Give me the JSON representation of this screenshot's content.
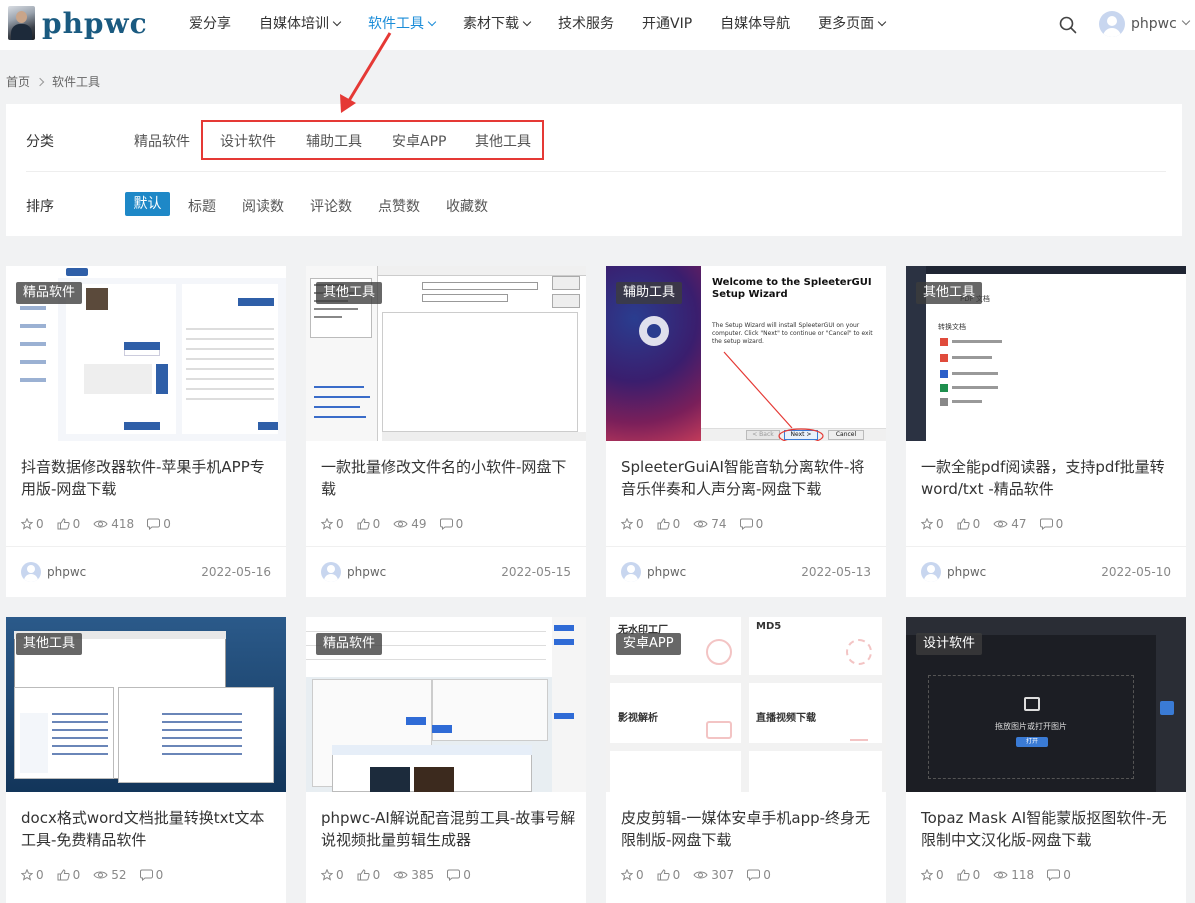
{
  "header": {
    "logo_text": "phpwc",
    "nav": [
      {
        "label": "爱分享",
        "dropdown": false,
        "active": false
      },
      {
        "label": "自媒体培训",
        "dropdown": true,
        "active": false
      },
      {
        "label": "软件工具",
        "dropdown": true,
        "active": true
      },
      {
        "label": "素材下载",
        "dropdown": true,
        "active": false
      },
      {
        "label": "技术服务",
        "dropdown": false,
        "active": false
      },
      {
        "label": "开通VIP",
        "dropdown": false,
        "active": false
      },
      {
        "label": "自媒体导航",
        "dropdown": false,
        "active": false
      },
      {
        "label": "更多页面",
        "dropdown": true,
        "active": false
      }
    ],
    "username": "phpwc"
  },
  "breadcrumb": {
    "home": "首页",
    "current": "软件工具"
  },
  "filter": {
    "category_label": "分类",
    "categories": [
      "精品软件",
      "设计软件",
      "辅助工具",
      "安卓APP",
      "其他工具"
    ],
    "sort_label": "排序",
    "sorts": [
      "默认",
      "标题",
      "阅读数",
      "评论数",
      "点赞数",
      "收藏数"
    ]
  },
  "cards": [
    {
      "tag": "精品软件",
      "title": "抖音数据修改器软件-苹果手机APP专用版-网盘下载",
      "stars": "0",
      "likes": "0",
      "views": "418",
      "comments": "0",
      "author": "phpwc",
      "date": "2022-05-16"
    },
    {
      "tag": "其他工具",
      "title": "一款批量修改文件名的小软件-网盘下载",
      "stars": "0",
      "likes": "0",
      "views": "49",
      "comments": "0",
      "author": "phpwc",
      "date": "2022-05-15"
    },
    {
      "tag": "辅助工具",
      "title": "SpleeterGuiAI智能音轨分离软件-将音乐伴奏和人声分离-网盘下载",
      "stars": "0",
      "likes": "0",
      "views": "74",
      "comments": "0",
      "author": "phpwc",
      "date": "2022-05-13"
    },
    {
      "tag": "其他工具",
      "title": "一款全能pdf阅读器，支持pdf批量转word/txt -精品软件",
      "stars": "0",
      "likes": "0",
      "views": "47",
      "comments": "0",
      "author": "phpwc",
      "date": "2022-05-10"
    },
    {
      "tag": "其他工具",
      "title": "docx格式word文档批量转换txt文本工具-免费精品软件",
      "stars": "0",
      "likes": "0",
      "views": "52",
      "comments": "0"
    },
    {
      "tag": "精品软件",
      "title": "phpwc-AI解说配音混剪工具-故事号解说视频批量剪辑生成器",
      "stars": "0",
      "likes": "0",
      "views": "385",
      "comments": "0"
    },
    {
      "tag": "安卓APP",
      "title": "皮皮剪辑-一媒体安卓手机app-终身无限制版-网盘下载",
      "stars": "0",
      "likes": "0",
      "views": "307",
      "comments": "0"
    },
    {
      "tag": "设计软件",
      "title": "Topaz Mask AI智能蒙版抠图软件-无限制中文汉化版-网盘下载",
      "stars": "0",
      "likes": "0",
      "views": "118",
      "comments": "0"
    }
  ],
  "thumb_text": {
    "spleeter_heading": "Welcome to the SpleeterGUI Setup Wizard",
    "spleeter_body": "The Setup Wizard will install SpleeterGUI on your computer. Click \"Next\" to continue or \"Cancel\" to exit the setup wizard.",
    "spleeter_back": "< Back",
    "spleeter_next": "Next >",
    "spleeter_cancel": "Cancel",
    "pdf_title": "PDF 文档",
    "pdf_convert": "转换文档",
    "pp_1": "无水印工厂",
    "pp_2": "MD5",
    "pp_3": "影视解析",
    "pp_4": "直播视频下载",
    "topaz_text": "拖放图片或打开图片",
    "topaz_btn": "打开"
  },
  "colors": {
    "accent": "#1a8cd8",
    "sort_active": "#1e88c7",
    "annotation": "#e53935"
  }
}
